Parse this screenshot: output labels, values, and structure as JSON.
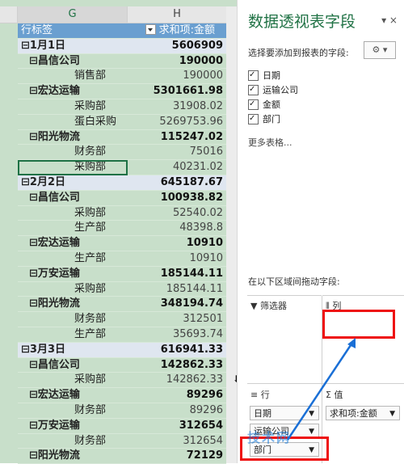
{
  "sheet": {
    "col_g": "G",
    "col_h": "H",
    "header_row_label": "行标签",
    "header_value_label": "求和项:金额",
    "rows": [
      {
        "label": "⊟1月1日",
        "value": "5606909",
        "level": 0,
        "bold": true,
        "date": true
      },
      {
        "label": "⊟昌信公司",
        "value": "190000",
        "level": 1,
        "bold": true
      },
      {
        "label": "销售部",
        "value": "190000",
        "level": 2
      },
      {
        "label": "⊟宏达运输",
        "value": "5301661.98",
        "level": 1,
        "bold": true
      },
      {
        "label": "采购部",
        "value": "31908.02",
        "level": 2
      },
      {
        "label": "蛋白采购",
        "value": "5269753.96",
        "level": 2
      },
      {
        "label": "⊟阳光物流",
        "value": "115247.02",
        "level": 1,
        "bold": true
      },
      {
        "label": "财务部",
        "value": "75016",
        "level": 2
      },
      {
        "label": "采购部",
        "value": "40231.02",
        "level": 2,
        "selected": true
      },
      {
        "label": "⊟2月2日",
        "value": "645187.67",
        "level": 0,
        "bold": true,
        "date": true
      },
      {
        "label": "⊟昌信公司",
        "value": "100938.82",
        "level": 1,
        "bold": true
      },
      {
        "label": "采购部",
        "value": "52540.02",
        "level": 2
      },
      {
        "label": "生产部",
        "value": "48398.8",
        "level": 2
      },
      {
        "label": "⊟宏达运输",
        "value": "10910",
        "level": 1,
        "bold": true
      },
      {
        "label": "生产部",
        "value": "10910",
        "level": 2
      },
      {
        "label": "⊟万安运输",
        "value": "185144.11",
        "level": 1,
        "bold": true
      },
      {
        "label": "采购部",
        "value": "185144.11",
        "level": 2
      },
      {
        "label": "⊟阳光物流",
        "value": "348194.74",
        "level": 1,
        "bold": true
      },
      {
        "label": "财务部",
        "value": "312501",
        "level": 2
      },
      {
        "label": "生产部",
        "value": "35693.74",
        "level": 2
      },
      {
        "label": "⊟3月3日",
        "value": "616941.33",
        "level": 0,
        "bold": true,
        "date": true
      },
      {
        "label": "⊟昌信公司",
        "value": "142862.33",
        "level": 1,
        "bold": true
      },
      {
        "label": "采购部",
        "value": "142862.33",
        "level": 2
      },
      {
        "label": "⊟宏达运输",
        "value": "89296",
        "level": 1,
        "bold": true
      },
      {
        "label": "财务部",
        "value": "89296",
        "level": 2
      },
      {
        "label": "⊟万安运输",
        "value": "312654",
        "level": 1,
        "bold": true
      },
      {
        "label": "财务部",
        "value": "312654",
        "level": 2
      },
      {
        "label": "⊟阳光物流",
        "value": "72129",
        "level": 1,
        "bold": true
      }
    ]
  },
  "pane": {
    "title": "数据透视表字段",
    "controls": "▾ ×",
    "description": "选择要添加到报表的字段:",
    "gear": "⚙ ▾",
    "fields": [
      "日期",
      "运输公司",
      "金额",
      "部门"
    ],
    "more_tables": "更多表格...",
    "drag_hint": "在以下区域间拖动字段:",
    "filters_title": "筛选器",
    "columns_title": "列",
    "rows_title": "行",
    "values_title": "值",
    "row_chips": [
      "日期",
      "运输公司",
      "部门"
    ],
    "value_chips": [
      "求和项:金额"
    ],
    "watermark": "技术网"
  },
  "colors": {
    "accent": "#217346",
    "highlight": "#e11111",
    "arrow": "#1a6fd6"
  }
}
